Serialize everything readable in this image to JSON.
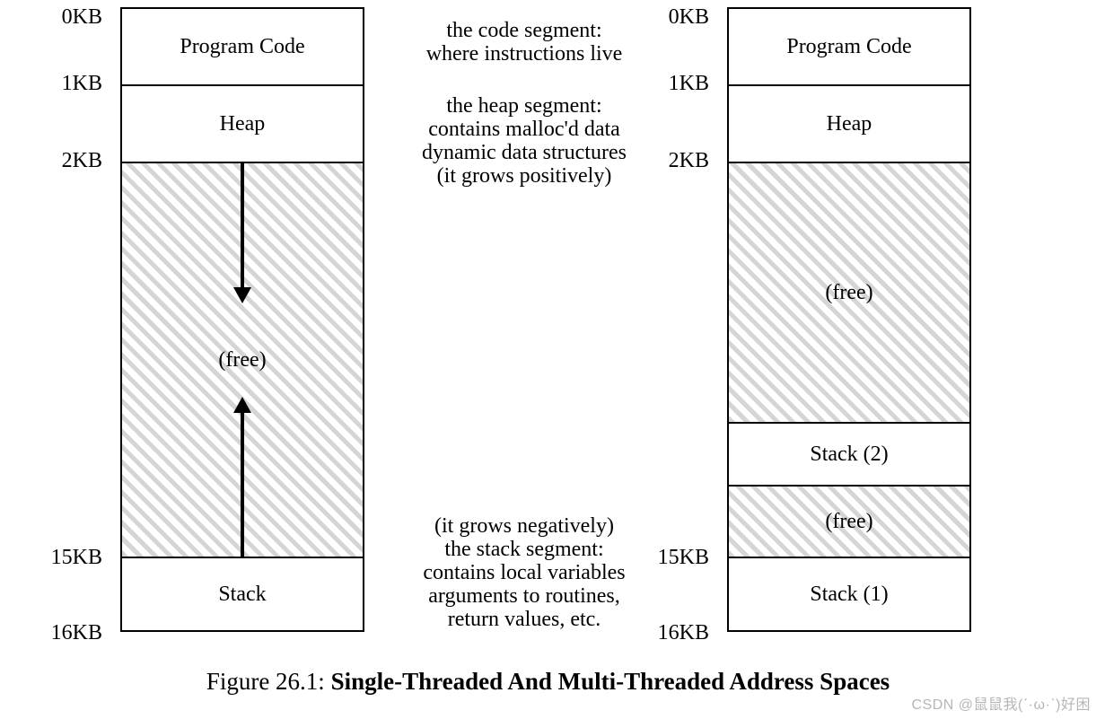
{
  "left": {
    "ticks": [
      "0KB",
      "1KB",
      "2KB",
      "15KB",
      "16KB"
    ],
    "segments": {
      "code": "Program Code",
      "heap": "Heap",
      "free": "(free)",
      "stack": "Stack"
    },
    "annotations": {
      "code": "the code segment:\nwhere instructions live",
      "heap": "the heap segment:\ncontains malloc'd data\ndynamic data structures\n(it grows positively)",
      "stack": "(it grows negatively)\nthe stack segment:\ncontains local variables\narguments to routines,\nreturn values, etc."
    }
  },
  "right": {
    "ticks": [
      "0KB",
      "1KB",
      "2KB",
      "15KB",
      "16KB"
    ],
    "segments": {
      "code": "Program Code",
      "heap": "Heap",
      "free1": "(free)",
      "stack2": "Stack (2)",
      "free2": "(free)",
      "stack1": "Stack (1)"
    }
  },
  "caption_prefix": "Figure 26.1: ",
  "caption_title": "Single-Threaded And Multi-Threaded Address Spaces",
  "watermark": "CSDN @鼠鼠我(ˊ·ω·ˋ)好困"
}
